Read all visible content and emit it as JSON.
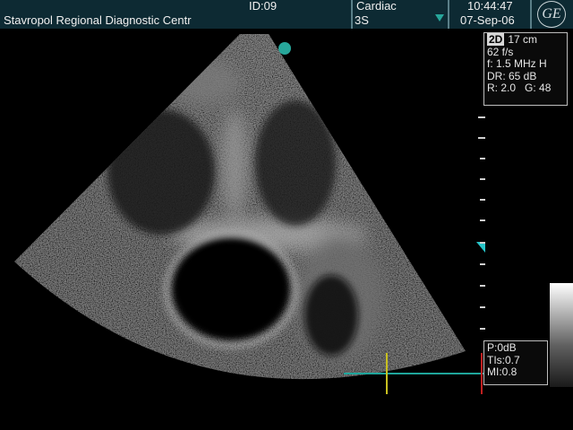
{
  "header": {
    "institution": "Stavropol Regional Diagnostic Centr",
    "patient_id": "ID:09",
    "exam_type": "Cardiac",
    "probe": "3S",
    "time": "10:44:47",
    "date": "07-Sep-06",
    "logo_text": "GE"
  },
  "imaging_params": {
    "mode": "2D",
    "depth": "17 cm",
    "frame_rate": "62 f/s",
    "frequency": "f: 1.5 MHz H",
    "dynamic_range": "DR: 65 dB",
    "reject": "R: 2.0",
    "gain": "G: 48"
  },
  "output_params": {
    "power": "P:0dB",
    "tis": "TIs:0.7",
    "mi": "MI:0.8"
  },
  "colors": {
    "header_bg": "#0d2a33",
    "marker_teal": "#27a69a",
    "ecg_line": "#1fa59b",
    "ecg_marker": "#c8c020",
    "ecg_end": "#c02020"
  }
}
